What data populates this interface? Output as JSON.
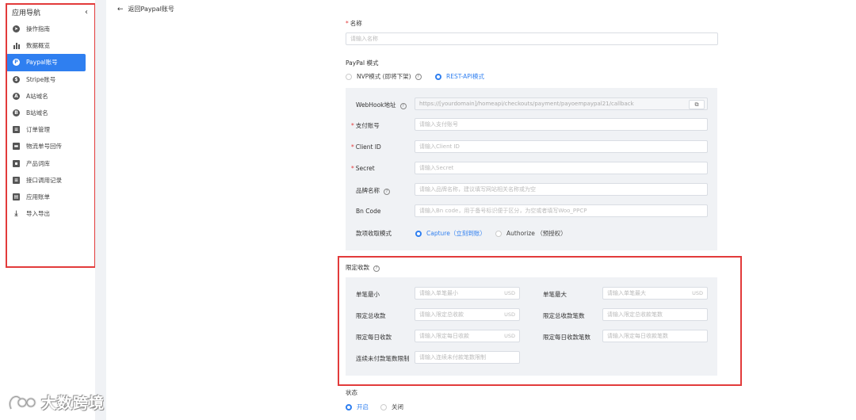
{
  "sidebar": {
    "title": "应用导航",
    "collapse_icon": "chevron-left-icon",
    "items": [
      {
        "label": "操作指南",
        "icon": "guide-icon"
      },
      {
        "label": "数据概览",
        "icon": "bar-chart-icon"
      },
      {
        "label": "Paypal账号",
        "icon": "paypal-icon",
        "active": true
      },
      {
        "label": "Stripe账号",
        "icon": "stripe-icon"
      },
      {
        "label": "A站域名",
        "icon": "a-site-icon"
      },
      {
        "label": "B站域名",
        "icon": "b-site-icon"
      },
      {
        "label": "订单管理",
        "icon": "clipboard-icon"
      },
      {
        "label": "物流单号回传",
        "icon": "truck-icon"
      },
      {
        "label": "产品词库",
        "icon": "product-icon"
      },
      {
        "label": "接口调用记录",
        "icon": "log-icon"
      },
      {
        "label": "应用账单",
        "icon": "bill-icon"
      },
      {
        "label": "导入导出",
        "icon": "download-icon"
      }
    ]
  },
  "header": {
    "back_label": "返回Paypal账号"
  },
  "form": {
    "name_label": "名称",
    "name_placeholder": "请输入名称",
    "mode_label": "PayPal 模式",
    "mode_options": [
      "NVP模式 (即将下架)",
      "REST-API模式"
    ],
    "mode_selected": "REST-API模式",
    "webhook_label": "WebHook地址",
    "webhook_value": "https://[yourdomain]/homeapi/checkouts/payment/payoempaypal21/callback",
    "account_label": "支付账号",
    "account_placeholder": "请输入支付账号",
    "client_id_label": "Client ID",
    "client_id_placeholder": "请输入Client ID",
    "secret_label": "Secret",
    "secret_placeholder": "请输入Secret",
    "brand_label": "品牌名称",
    "brand_placeholder": "请输入品牌名称，建议填写网站相关名称或为空",
    "bn_label": "Bn Code",
    "bn_placeholder": "请输入Bn code，用于备号标识便于区分，为空或者填写Woo_PPCP",
    "capture_label": "款项收取模式",
    "capture_options": [
      "Capture（立刻到账）",
      "Authorize （预授权）"
    ],
    "capture_selected": "Capture（立刻到账）"
  },
  "limit": {
    "title": "限定收款",
    "min_label": "单笔最小",
    "min_placeholder": "请输入单笔最小",
    "max_label": "单笔最大",
    "max_placeholder": "请输入单笔最大",
    "total_label": "限定总收款",
    "total_placeholder": "请输入限定总收款",
    "total_count_label": "限定总收款笔数",
    "total_count_placeholder": "请输入限定总收款笔数",
    "daily_label": "限定每日收款",
    "daily_placeholder": "请输入限定每日收款",
    "daily_count_label": "限定每日收款笔数",
    "daily_count_placeholder": "请输入限定每日收款笔数",
    "unpaid_label": "连续未付款笔数限制",
    "unpaid_placeholder": "请输入连续未付款笔数限制",
    "currency": "USD"
  },
  "status": {
    "label": "状态",
    "options": [
      "开启",
      "关闭"
    ],
    "selected": "开启"
  },
  "watermark": {
    "text": "大数跨境"
  },
  "colors": {
    "accent": "#2f7ff0",
    "highlight_box": "#e23b3b",
    "panel": "#f0f2f5"
  }
}
